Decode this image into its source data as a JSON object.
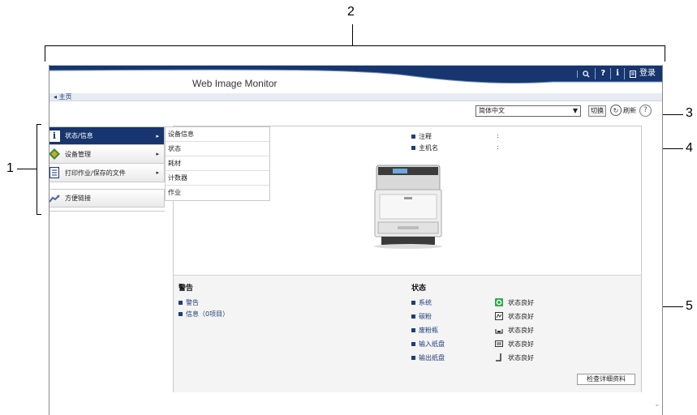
{
  "callouts": [
    "1",
    "2",
    "3",
    "4",
    "5"
  ],
  "header": {
    "title": "Web Image Monitor",
    "login": "登录"
  },
  "breadcrumb": "◂ 主页",
  "language": {
    "selected": "简体中文",
    "switch": "切换",
    "refresh": "刷新"
  },
  "menu": {
    "items": [
      {
        "label": "状态/信息",
        "icon": "info-icon"
      },
      {
        "label": "设备管理",
        "icon": "device-management-icon"
      },
      {
        "label": "打印作业/保存的文件",
        "icon": "document-icon"
      }
    ],
    "favorites": "方便链接"
  },
  "submenu": [
    "设备信息",
    "状态",
    "耗材",
    "计数器",
    "作业"
  ],
  "device_info": [
    {
      "label": "注释",
      "value": ":"
    },
    {
      "label": "主机名",
      "value": ":"
    }
  ],
  "alerts": {
    "title": "警告",
    "items": [
      "警告",
      "信息（0项目）"
    ]
  },
  "status": {
    "title": "状态",
    "items": [
      {
        "label": "系统",
        "value": "状态良好",
        "icon": "system-ok-icon"
      },
      {
        "label": "碳粉",
        "value": "状态良好",
        "icon": "toner-icon"
      },
      {
        "label": "废粉瓶",
        "value": "状态良好",
        "icon": "waste-toner-icon"
      },
      {
        "label": "输入纸盘",
        "value": "状态良好",
        "icon": "input-tray-icon"
      },
      {
        "label": "输出纸盘",
        "value": "状态良好",
        "icon": "output-tray-icon"
      }
    ],
    "detail_button": "检查详细资料"
  },
  "colors": {
    "nav_dark": "#17356e",
    "link": "#1d3e78",
    "ok_green": "#2fa84a"
  }
}
